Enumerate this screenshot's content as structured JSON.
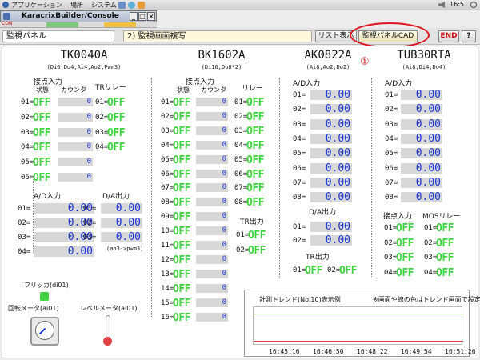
{
  "topbar": {
    "apps": "アプリケーション",
    "places": "場所",
    "system": "システム",
    "clock": "16:51"
  },
  "window": {
    "title": "KaracrixBuilder/Console",
    "con": "CON"
  },
  "header": {
    "monitor_panel": "監視パネル",
    "current_screen": "2) 監視画面複写",
    "list_btn": "リスト表示",
    "cad_btn": "監視パネルCAD",
    "end_btn": "END",
    "help_btn": "?"
  },
  "annotation": {
    "marker": "①"
  },
  "devices": {
    "tk": {
      "name": "TK0040A",
      "spec": "(Di6,Do4,Ai4,Ao2,Pwm3)",
      "contact_title": "接点入力",
      "status_h": "状態",
      "count_h": "カウンタ",
      "tr_relay_title": "TRリレー",
      "inputs": [
        [
          "01=",
          "OFF",
          "0"
        ],
        [
          "02=",
          "OFF",
          "0"
        ],
        [
          "03=",
          "OFF",
          "0"
        ],
        [
          "04=",
          "OFF",
          "0"
        ],
        [
          "05=",
          "OFF",
          "0"
        ],
        [
          "06=",
          "OFF",
          "0"
        ]
      ],
      "relays": [
        [
          "01=",
          "OFF"
        ],
        [
          "02=",
          "OFF"
        ],
        [
          "03=",
          "OFF"
        ],
        [
          "04=",
          "OFF"
        ]
      ],
      "ad_title": "A/D入力",
      "da_title": "D/A出力",
      "ad": [
        [
          "01=",
          "0.00"
        ],
        [
          "02=",
          "0.00"
        ],
        [
          "03=",
          "0.00"
        ],
        [
          "04=",
          "0.00"
        ]
      ],
      "da": [
        [
          "01=",
          "0.00"
        ],
        [
          "02=",
          "0.00"
        ],
        [
          "03=",
          "0.00"
        ]
      ],
      "da_note": "(ao3->pwm3)",
      "flicker": "フリッカ(di01)",
      "rot_meter": "回転メータ(ai01)",
      "lvl_meter": "レベルメータ(ai01)"
    },
    "bk": {
      "name": "BK1602A",
      "spec": "(Di16,Do8*2)",
      "contact_title": "接点入力",
      "status_h": "状態",
      "count_h": "カウンタ",
      "relay_title": "リレー",
      "tr_title": "TR出力",
      "inputs": [
        [
          "01=",
          "OFF",
          "0"
        ],
        [
          "02=",
          "OFF",
          "0"
        ],
        [
          "03=",
          "OFF",
          "0"
        ],
        [
          "04=",
          "OFF",
          "0"
        ],
        [
          "05=",
          "OFF",
          "0"
        ],
        [
          "06=",
          "OFF",
          "0"
        ],
        [
          "07=",
          "OFF",
          "0"
        ],
        [
          "08=",
          "OFF",
          "0"
        ],
        [
          "09=",
          "OFF",
          "0"
        ],
        [
          "10=",
          "OFF",
          "0"
        ],
        [
          "11=",
          "OFF",
          "0"
        ],
        [
          "12=",
          "OFF",
          "0"
        ],
        [
          "13=",
          "OFF",
          "0"
        ],
        [
          "14=",
          "OFF",
          "0"
        ],
        [
          "15=",
          "OFF",
          "0"
        ],
        [
          "16=",
          "OFF",
          "0"
        ]
      ],
      "relays": [
        [
          "01=",
          "OFF"
        ],
        [
          "02=",
          "OFF"
        ],
        [
          "03=",
          "OFF"
        ],
        [
          "04=",
          "OFF"
        ],
        [
          "05=",
          "OFF"
        ],
        [
          "06=",
          "OFF"
        ],
        [
          "07=",
          "OFF"
        ],
        [
          "08=",
          "OFF"
        ]
      ],
      "tr": [
        [
          "01=",
          "OFF"
        ],
        [
          "02=",
          "OFF"
        ]
      ]
    },
    "ak": {
      "name": "AK0822A",
      "spec": "(Ai8,Ao2,Do2)",
      "ad_title": "A/D入力",
      "da_title": "D/A出力",
      "tr_title": "TR出力",
      "ad": [
        [
          "01=",
          "0.00"
        ],
        [
          "02=",
          "0.00"
        ],
        [
          "03=",
          "0.00"
        ],
        [
          "04=",
          "0.00"
        ],
        [
          "05=",
          "0.00"
        ],
        [
          "06=",
          "0.00"
        ],
        [
          "07=",
          "0.00"
        ],
        [
          "08=",
          "0.00"
        ]
      ],
      "da": [
        [
          "01=",
          "0.00"
        ],
        [
          "02=",
          "0.00"
        ]
      ],
      "tr": [
        [
          "01=",
          "OFF"
        ],
        [
          "02=",
          "OFF"
        ]
      ]
    },
    "tu": {
      "name": "TUB30RTA",
      "spec": "(Ai8,Di4,Do4)",
      "ad_title": "A/D入力",
      "contact_title": "接点入力",
      "mos_title": "MOSリレー",
      "ad": [
        [
          "01=",
          "0.00"
        ],
        [
          "02=",
          "0.00"
        ],
        [
          "03=",
          "0.00"
        ],
        [
          "04=",
          "0.00"
        ],
        [
          "05=",
          "0.00"
        ],
        [
          "06=",
          "0.00"
        ],
        [
          "07=",
          "0.00"
        ],
        [
          "08=",
          "0.00"
        ]
      ],
      "inputs": [
        [
          "01=",
          "OFF"
        ],
        [
          "02=",
          "OFF"
        ],
        [
          "03=",
          "OFF"
        ],
        [
          "04=",
          "OFF"
        ]
      ],
      "relays": [
        [
          "01=",
          "OFF"
        ],
        [
          "02=",
          "OFF"
        ],
        [
          "03=",
          "OFF"
        ],
        [
          "04=",
          "OFF"
        ]
      ]
    }
  },
  "trend": {
    "title": "計測トレンド(No.10)表示例",
    "note": "※画面や線の色はトレンド画面で設定",
    "times": [
      "16:45:16",
      "16:46:50",
      "16:48:22",
      "16:49:54",
      "16:51:26"
    ],
    "colors": {
      "line_top": "#a6d98c",
      "line_bottom": "#e04040"
    }
  },
  "colors": {
    "off": "#3fd33f",
    "value": "#1a35d6",
    "highlight": "#e0141e"
  }
}
